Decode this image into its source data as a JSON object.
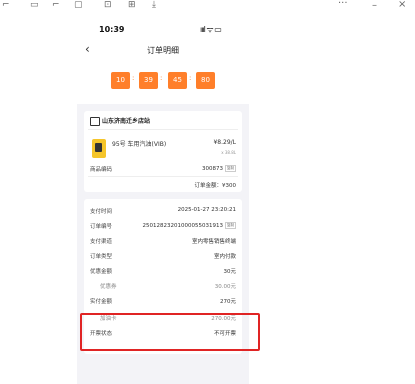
{
  "phone": {
    "time": "10:39",
    "signal": "ıııl ᯤ ▭",
    "nav_title": "订单明细",
    "timer": [
      "10",
      "39",
      "45",
      "80"
    ],
    "store_name": "山东济南迁乡店站",
    "fuel": {
      "name": "95号 车用汽油(VIB)",
      "price": "¥8.29/L",
      "sub": "x 38.8L"
    },
    "product_code": {
      "label": "商品编码",
      "value": "300873",
      "tag": "复制"
    },
    "order_amount": "订单金额：¥300",
    "details": [
      {
        "label": "支付时间",
        "value": "2025-01-27 23:20:21"
      },
      {
        "label": "订单编号",
        "value": "25012823201000055031913",
        "tag": "复制"
      },
      {
        "label": "支付渠道",
        "value": "室内零售销售终端"
      },
      {
        "label": "订单类型",
        "value": "室内付款"
      },
      {
        "label": "优惠金额",
        "value": "30元"
      },
      {
        "label": "优惠券",
        "value": "30.00元",
        "sub": true
      },
      {
        "label": "实付金额",
        "value": "270元"
      },
      {
        "label": "加油卡",
        "value": "270.00元",
        "sub": true
      },
      {
        "label": "开票状态",
        "value": "不可开票"
      }
    ]
  },
  "colors": {
    "accent": "#ff7f2a",
    "highlight": "#e02424",
    "fuel_icon": "#f5c52a"
  }
}
